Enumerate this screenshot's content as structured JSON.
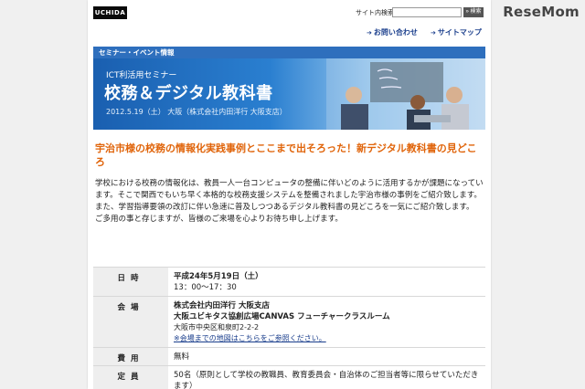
{
  "watermark": "ReseMom",
  "header": {
    "logo": "UCHIDA",
    "site_search_label": "サイト内検索",
    "search_placeholder": "",
    "search_button": "» 検索"
  },
  "nav": {
    "inquiry": "お問い合わせ",
    "sitemap": "サイトマップ"
  },
  "banner": {
    "tab_label": "セミナー・イベント情報",
    "subtitle": "ICT利活用セミナー",
    "title": "校務＆デジタル教科書",
    "date_line": "2012.5.19（土） 大阪（株式会社内田洋行 大阪支店）"
  },
  "headline": "宇治市様の校務の情報化実践事例とここまで出そろった！新デジタル教科書の見どころ",
  "intro": [
    "学校における校務の情報化は、教員一人一台コンピュータの整備に伴いどのように活用するかが課題になっています。そこで関西でもいち早く本格的な校務支援システムを整備されました宇治市様の事例をご紹介致します。",
    "また、学習指導要領の改訂に伴い急速に普及しつつあるデジタル教科書の見どころを一気にご紹介致します。",
    "ご多用の事と存じますが、皆様のご来場を心よりお待ち申し上げます。"
  ],
  "info": {
    "date_label": "日時",
    "date_value": "平成24年5月19日（土）",
    "time_value": "13：00～17：30",
    "venue_label": "会場",
    "venue_line1": "株式会社内田洋行 大阪支店",
    "venue_line2": "大阪ユビキタス協創広場CANVAS フューチャークラスルーム",
    "venue_address": "大阪市中央区和泉町2-2-2",
    "venue_map_link": "※会場までの地図はこちらをご参照ください。",
    "fee_label": "費用",
    "fee_value": "無料",
    "capacity_label": "定員",
    "capacity_value": "50名（原則として学校の教職員、教育委員会・自治体のご担当者等に限らせていただきます）"
  }
}
